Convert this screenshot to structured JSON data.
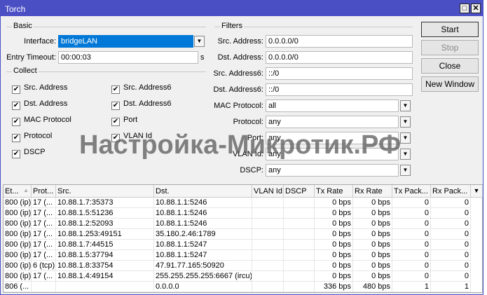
{
  "window": {
    "title": "Torch"
  },
  "basic": {
    "header": "Basic",
    "interface_label": "Interface:",
    "interface_value": "bridgeLAN",
    "timeout_label": "Entry Timeout:",
    "timeout_value": "00:00:03",
    "timeout_unit": "s"
  },
  "collect": {
    "header": "Collect",
    "items": [
      {
        "label": "Src. Address",
        "checked": true
      },
      {
        "label": "Src. Address6",
        "checked": true
      },
      {
        "label": "Dst. Address",
        "checked": true
      },
      {
        "label": "Dst. Address6",
        "checked": true
      },
      {
        "label": "MAC Protocol",
        "checked": true
      },
      {
        "label": "Port",
        "checked": true
      },
      {
        "label": "Protocol",
        "checked": true
      },
      {
        "label": "VLAN Id",
        "checked": true
      },
      {
        "label": "DSCP",
        "checked": true
      }
    ]
  },
  "filters": {
    "header": "Filters",
    "rows": [
      {
        "label": "Src. Address:",
        "value": "0.0.0.0/0",
        "dropdown": false
      },
      {
        "label": "Dst. Address:",
        "value": "0.0.0.0/0",
        "dropdown": false
      },
      {
        "label": "Src. Address6:",
        "value": "::/0",
        "dropdown": false
      },
      {
        "label": "Dst. Address6:",
        "value": "::/0",
        "dropdown": false
      },
      {
        "label": "MAC Protocol:",
        "value": "all",
        "dropdown": true
      },
      {
        "label": "Protocol:",
        "value": "any",
        "dropdown": true
      },
      {
        "label": "Port:",
        "value": "any",
        "dropdown": true
      },
      {
        "label": "VLAN Id:",
        "value": "any",
        "dropdown": true
      },
      {
        "label": "DSCP:",
        "value": "any",
        "dropdown": true
      }
    ]
  },
  "buttons": {
    "start": "Start",
    "stop": "Stop",
    "close": "Close",
    "new_window": "New Window"
  },
  "table": {
    "columns": [
      "Et...",
      "Prot...",
      "Src.",
      "Dst.",
      "VLAN Id",
      "DSCP",
      "Tx Rate",
      "Rx Rate",
      "Tx Pack...",
      "Rx Pack..."
    ],
    "rows": [
      [
        "800 (ip)",
        "17 (...",
        "10.88.1.7:35373",
        "10.88.1.1:5246",
        "",
        "",
        "0 bps",
        "0 bps",
        "0",
        "0"
      ],
      [
        "800 (ip)",
        "17 (...",
        "10.88.1.5:51236",
        "10.88.1.1:5246",
        "",
        "",
        "0 bps",
        "0 bps",
        "0",
        "0"
      ],
      [
        "800 (ip)",
        "17 (...",
        "10.88.1.2:52093",
        "10.88.1.1:5246",
        "",
        "",
        "0 bps",
        "0 bps",
        "0",
        "0"
      ],
      [
        "800 (ip)",
        "17 (...",
        "10.88.1.253:49151",
        "35.180.2.46:1789",
        "",
        "",
        "0 bps",
        "0 bps",
        "0",
        "0"
      ],
      [
        "800 (ip)",
        "17 (...",
        "10.88.1.7:44515",
        "10.88.1.1:5247",
        "",
        "",
        "0 bps",
        "0 bps",
        "0",
        "0"
      ],
      [
        "800 (ip)",
        "17 (...",
        "10.88.1.5:37794",
        "10.88.1.1:5247",
        "",
        "",
        "0 bps",
        "0 bps",
        "0",
        "0"
      ],
      [
        "800 (ip)",
        "6 (tcp)",
        "10.88.1.8:33754",
        "47.91.77.165:50920",
        "",
        "",
        "0 bps",
        "0 bps",
        "0",
        "0"
      ],
      [
        "800 (ip)",
        "17 (...",
        "10.88.1.4:49154",
        "255.255.255.255:6667 (ircu)",
        "",
        "",
        "0 bps",
        "0 bps",
        "0",
        "0"
      ],
      [
        "806 (...",
        "",
        "",
        "0.0.0.0",
        "",
        "",
        "336 bps",
        "480 bps",
        "1",
        "1"
      ]
    ]
  },
  "watermark": "Настройка-Микротик.РФ"
}
